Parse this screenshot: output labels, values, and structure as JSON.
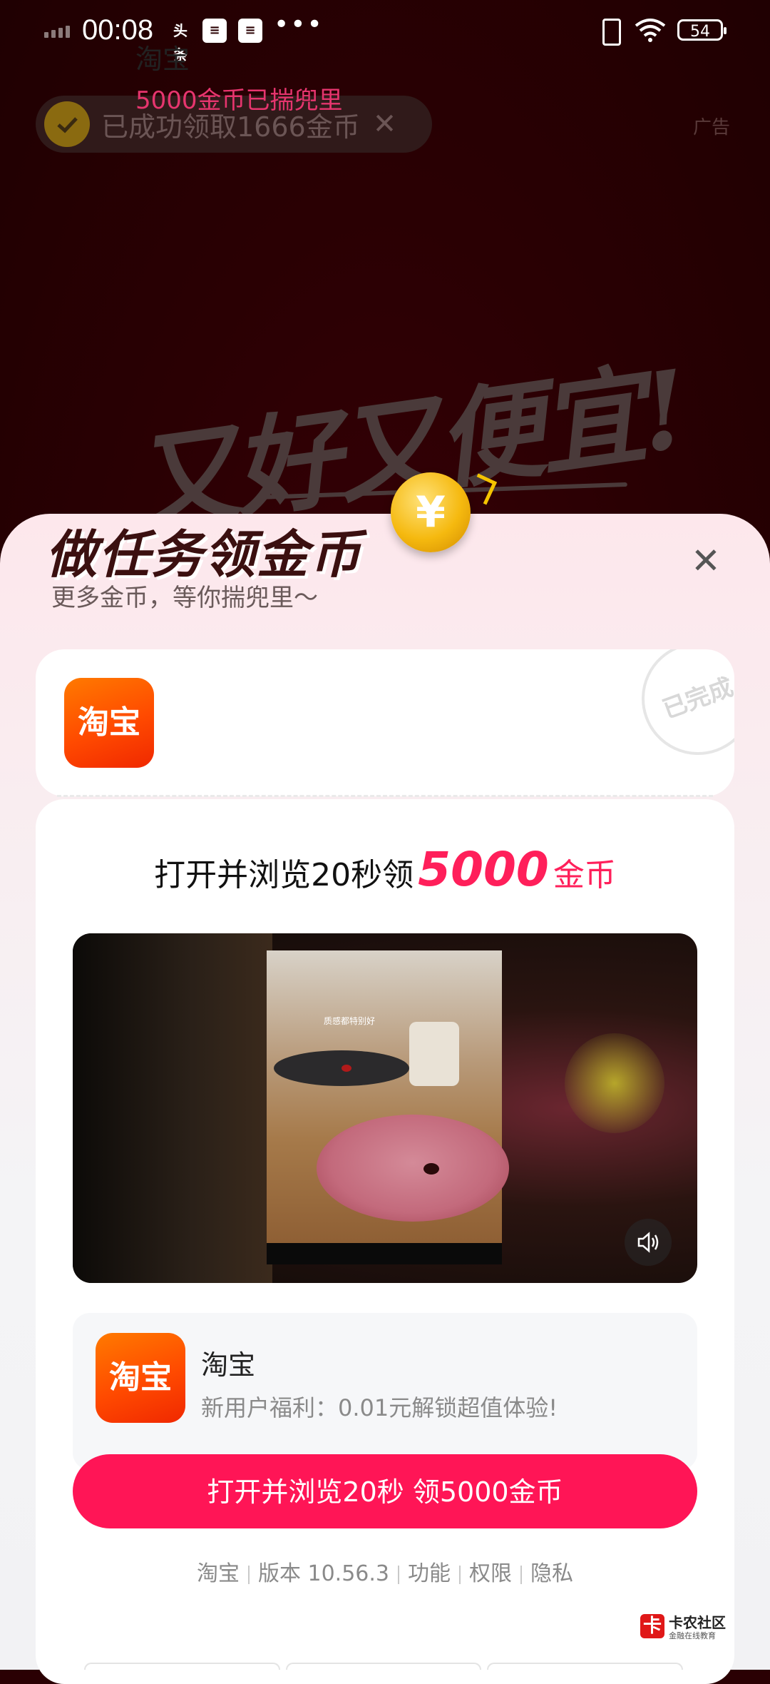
{
  "status_bar": {
    "time": "00:08",
    "notif_app": "头条",
    "more": "•••",
    "battery": "54"
  },
  "background_ad": {
    "slogan": "又好又便宜!",
    "ad_label": "广告"
  },
  "toast": {
    "text": "已成功领取1666金币",
    "close": "✕"
  },
  "sheet": {
    "title": "做任务领金币",
    "subtitle": "更多金币，等你揣兜里～",
    "close": "✕",
    "coin_symbol": "¥"
  },
  "completed_task": {
    "icon_text": "淘宝",
    "app_name": "淘宝",
    "status": "5000金币已揣兜里",
    "stamp": "已完成"
  },
  "task": {
    "headline_prefix": "打开并浏览20秒领",
    "headline_amount": "5000",
    "headline_suffix": "金币",
    "video_caption": "质感都特别好",
    "app_icon_text": "淘宝",
    "app_name": "淘宝",
    "app_desc": "新用户福利：0.01元解锁超值体验!",
    "cta_label": "打开并浏览20秒 领5000金币",
    "meta": {
      "developer": "淘宝",
      "version": "版本 10.56.3",
      "features": "功能",
      "permissions": "权限",
      "privacy": "隐私"
    }
  },
  "watermark": {
    "logo": "卡",
    "title": "卡农社区",
    "subtitle": "金融在线教育"
  },
  "colors": {
    "accent": "#ff1556",
    "amount": "#ff1f5a",
    "status_pink": "#e6356e",
    "taobao_orange": "#ff5000"
  }
}
